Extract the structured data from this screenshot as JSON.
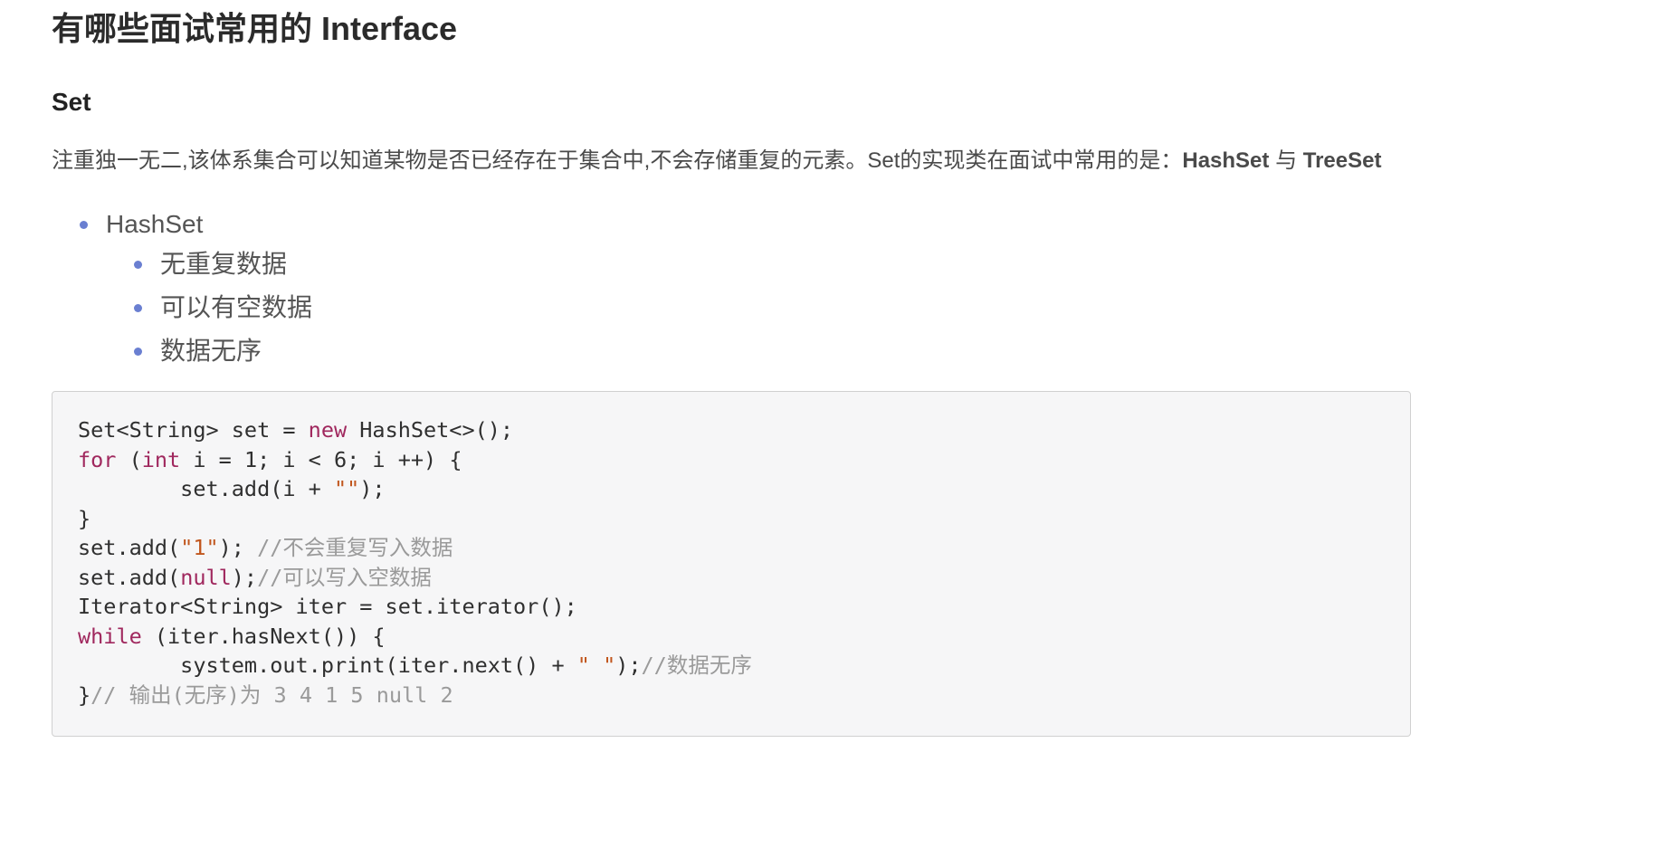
{
  "heading": "有哪些面试常用的 Interface",
  "section": {
    "title": "Set",
    "paragraph_text": "注重独一无二,该体系集合可以知道某物是否已经存在于集合中,不会存储重复的元素。Set的实现类在面试中常用的是：",
    "paragraph_hashset": "HashSet",
    "paragraph_conj": " 与 ",
    "paragraph_treeset": "TreeSet"
  },
  "list": {
    "item": "HashSet",
    "subitems": [
      "无重复数据",
      "可以有空数据",
      "数据无序"
    ]
  },
  "code": {
    "line1_a": "Set<String> set = ",
    "line1_kw": "new",
    "line1_b": " HashSet<>();",
    "line2_kw1": "for",
    "line2_a": " (",
    "line2_kw2": "int",
    "line2_b": " i = 1; i < 6; i ++) {",
    "line3_a": "        set.add(i + ",
    "line3_str": "\"\"",
    "line3_b": ");",
    "line4": "}",
    "line5_a": "set.add(",
    "line5_str": "\"1\"",
    "line5_b": "); ",
    "line5_cmt": "//不会重复写入数据",
    "line6_a": "set.add(",
    "line6_kw": "null",
    "line6_b": ");",
    "line6_cmt": "//可以写入空数据",
    "line7": "Iterator<String> iter = set.iterator();",
    "line8_kw": "while",
    "line8_a": " (iter.hasNext()) {",
    "line9_a": "        system.out.print(iter.next() + ",
    "line9_str": "\" \"",
    "line9_b": ");",
    "line9_cmt": "//数据无序",
    "line10_a": "}",
    "line10_cmt": "// 输出(无序)为 3 4 1 5 null 2"
  },
  "colors": {
    "keyword": "#a0285e",
    "string": "#c1561d",
    "comment": "#9a9a9a",
    "bullet": "#6a7fd1",
    "code_background": "#f6f6f7"
  }
}
